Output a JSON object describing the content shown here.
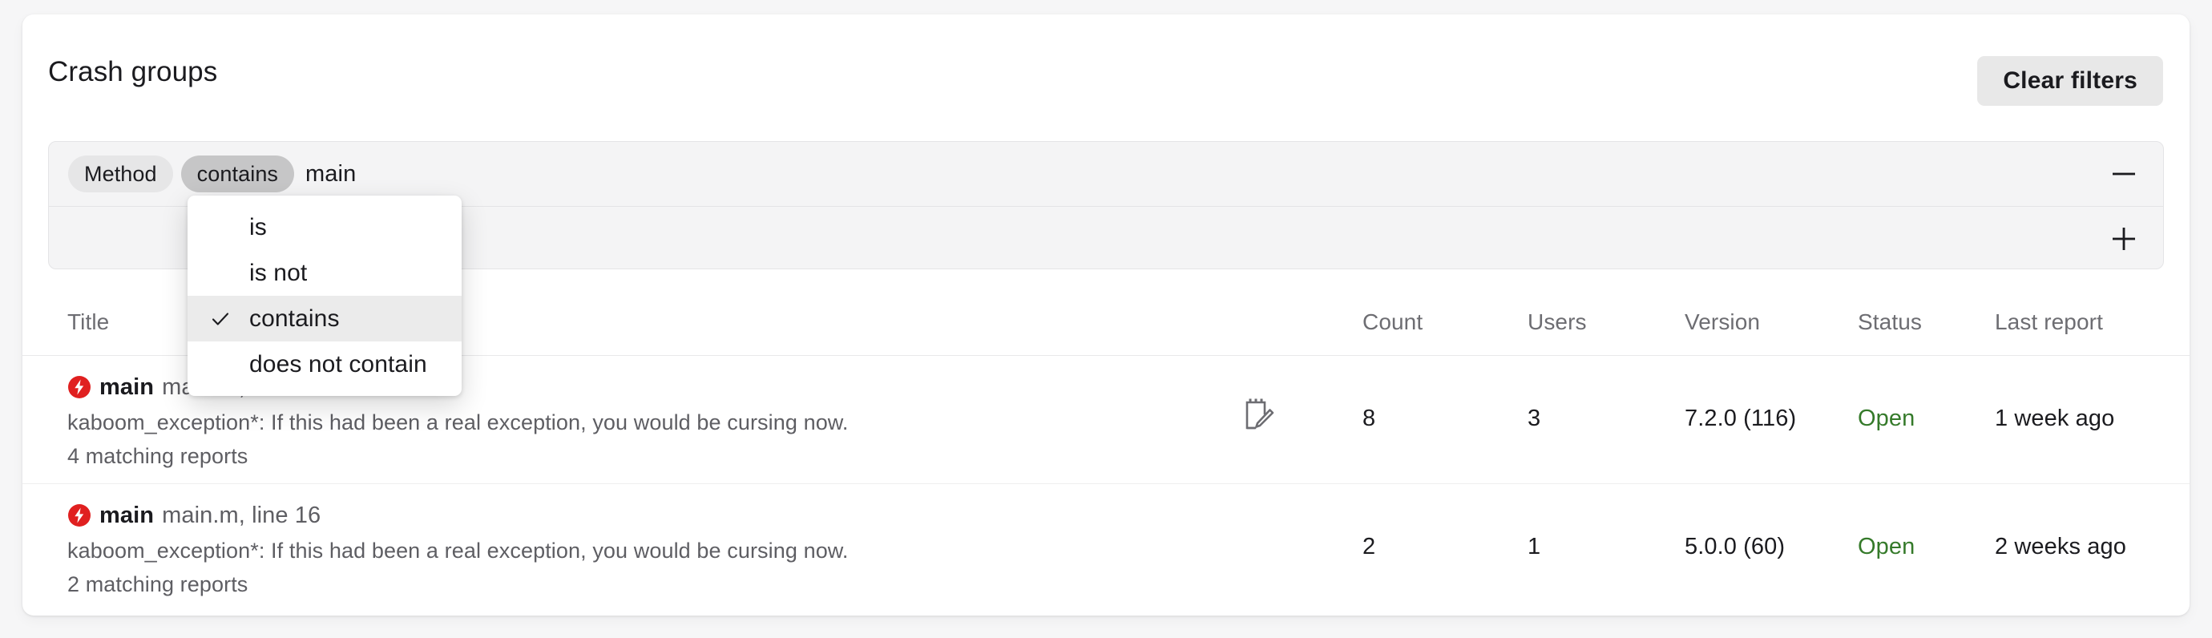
{
  "header": {
    "title": "Crash groups",
    "clear_filters_label": "Clear filters"
  },
  "filters": {
    "rows": [
      {
        "field_label": "Method",
        "operator_label": "contains",
        "value": "main",
        "action_icon": "minus-icon"
      },
      {
        "field_label": "",
        "operator_label": "",
        "value": "",
        "action_icon": "plus-icon"
      }
    ],
    "operator_dropdown": {
      "open": true,
      "selected": "contains",
      "options": [
        {
          "label": "is",
          "checked": false
        },
        {
          "label": "is not",
          "checked": false
        },
        {
          "label": "contains",
          "checked": true
        },
        {
          "label": "does not contain",
          "checked": false
        }
      ]
    }
  },
  "table": {
    "columns": [
      {
        "key": "title",
        "label": "Title"
      },
      {
        "key": "count",
        "label": "Count"
      },
      {
        "key": "users",
        "label": "Users"
      },
      {
        "key": "version",
        "label": "Version"
      },
      {
        "key": "status",
        "label": "Status"
      },
      {
        "key": "last_report",
        "label": "Last report"
      }
    ],
    "rows": [
      {
        "icon": "crash-bolt-icon",
        "method": "main",
        "location": "main.m, line 16",
        "exception": "kaboom_exception*: If this had been a real exception, you would be cursing now.",
        "matching_reports": "4 matching reports",
        "has_note": true,
        "note_icon": "note-edit-icon",
        "count": "8",
        "users": "3",
        "version": "7.2.0 (116)",
        "status": "Open",
        "last_report": "1 week ago"
      },
      {
        "icon": "crash-bolt-icon",
        "method": "main",
        "location": "main.m, line 16",
        "exception": "kaboom_exception*: If this had been a real exception, you would be cursing now.",
        "matching_reports": "2 matching reports",
        "has_note": false,
        "note_icon": "",
        "count": "2",
        "users": "1",
        "version": "5.0.0 (60)",
        "status": "Open",
        "last_report": "2 weeks ago"
      }
    ]
  },
  "colors": {
    "crash_icon_red": "#e02020",
    "status_open_green": "#357a2a",
    "chip_field_bg": "#e6e6e7",
    "chip_operator_bg": "#c6c6c7",
    "panel_bg": "#f4f4f5",
    "page_bg": "#f6f6f7"
  }
}
